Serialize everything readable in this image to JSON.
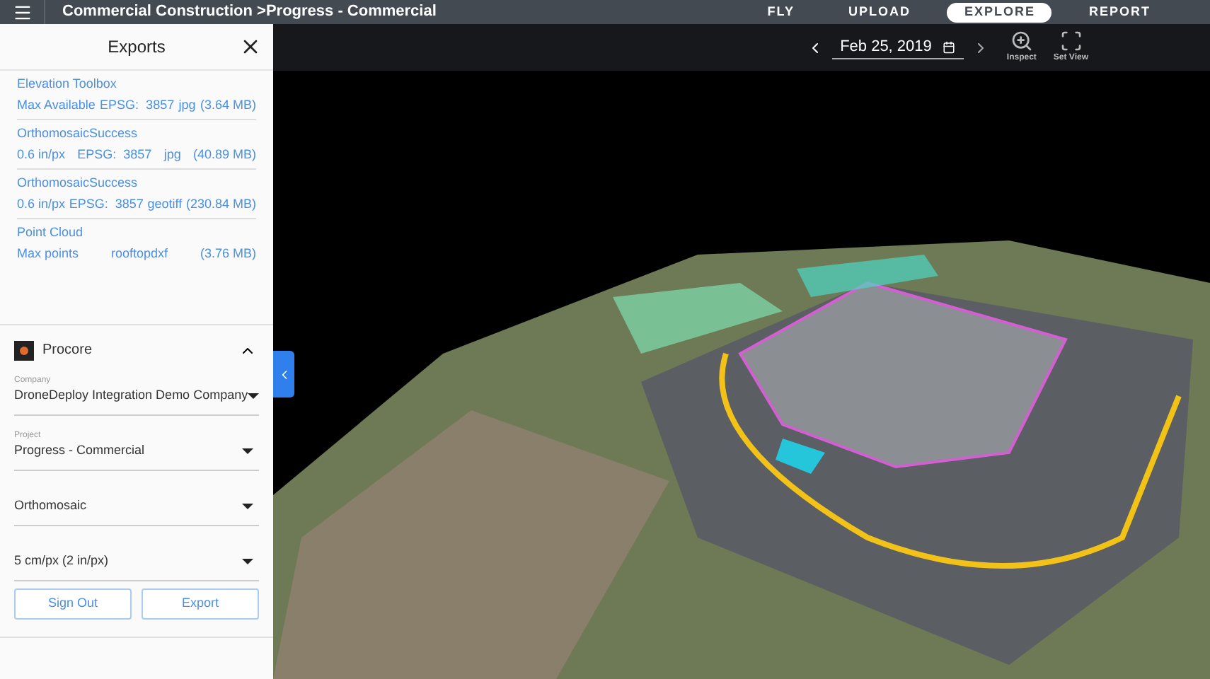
{
  "top_bar": {
    "breadcrumb": "Commercial Construction >Progress - Commercial",
    "nav": [
      {
        "label": "FLY",
        "selected": false
      },
      {
        "label": "UPLOAD",
        "selected": false
      },
      {
        "label": "EXPLORE",
        "selected": true
      },
      {
        "label": "REPORT",
        "selected": false
      }
    ]
  },
  "exports_panel": {
    "title": "Exports",
    "items": [
      {
        "title": "Elevation Toolbox",
        "meta": [
          "Max Available",
          "EPSG:  3857",
          "jpg",
          "(3.64 MB)"
        ]
      },
      {
        "title": "OrthomosaicSuccess",
        "meta": [
          "0.6 in/px",
          "EPSG:  3857",
          "jpg",
          "(40.89 MB)"
        ]
      },
      {
        "title": "OrthomosaicSuccess",
        "meta": [
          "0.6 in/px",
          "EPSG:  3857",
          "geotiff",
          "(230.84 MB)"
        ]
      },
      {
        "title": "Point Cloud",
        "meta": [
          "Max points",
          "rooftopdxf",
          "(3.76 MB)"
        ]
      }
    ],
    "integration": {
      "name": "Procore",
      "expanded": true,
      "fields": [
        {
          "label": "Company",
          "value": "DroneDeploy Integration Demo Company"
        },
        {
          "label": "Project",
          "value": "Progress - Commercial"
        },
        {
          "value": "Orthomosaic"
        },
        {
          "value": "5 cm/px (2 in/px)"
        }
      ],
      "buttons": [
        "Sign Out",
        "Export"
      ]
    }
  },
  "map_toolbar": {
    "date": "Feb 25, 2019",
    "tools": [
      {
        "kind": "inspect",
        "label": "Inspect"
      },
      {
        "kind": "setview",
        "label": "Set View"
      }
    ]
  }
}
